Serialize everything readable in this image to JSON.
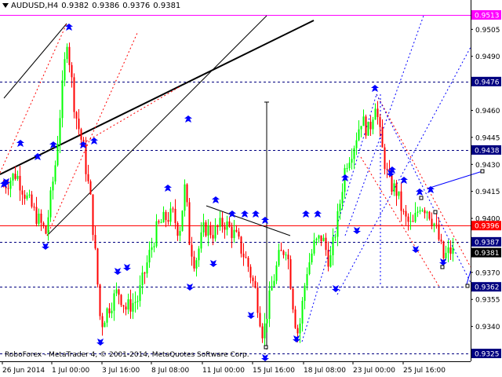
{
  "header": {
    "symbol_timeframe": "AUDUSD,H4",
    "open": "0.9382",
    "high": "0.9386",
    "low": "0.9376",
    "close": "0.9381"
  },
  "copyright": "RoboForex - MetaTrader 4, © 2001-2014, MetaQuotes Software Corp.",
  "colors": {
    "bull": "#00ff00",
    "bear": "#ff0000",
    "level_line": "#000080",
    "label_bg": "#000080",
    "label_text": "#ffffff",
    "current_price_label_bg": "#000000",
    "top_label_bg": "#ff00ff",
    "red_line": "#ff0000",
    "arrow_blue": "#0000ff",
    "trend_blue": "#0000ff",
    "trend_black": "#000000"
  },
  "chart_data": {
    "type": "candlestick",
    "symbol": "AUDUSD",
    "timeframe": "H4",
    "ylim": [
      0.9318,
      0.952
    ],
    "y_ticks": [
      "0.9505",
      "0.9490",
      "0.9460",
      "0.9445",
      "0.9430",
      "0.9415",
      "0.9400",
      "0.9370",
      "0.9355",
      "0.9340"
    ],
    "x_ticks": [
      "26 Jun 2014",
      "1 Jul 00:00",
      "3 Jul 16:00",
      "8 Jul 08:00",
      "11 Jul 00:00",
      "15 Jul 16:00",
      "18 Jul 08:00",
      "23 Jul 00:00",
      "25 Jul 16:00"
    ],
    "price_labels": [
      {
        "value": "0.9513",
        "style": "magenta"
      },
      {
        "value": "0.9476",
        "style": "navy"
      },
      {
        "value": "0.9438",
        "style": "navy"
      },
      {
        "value": "0.9396",
        "style": "red"
      },
      {
        "value": "0.9387",
        "style": "navy"
      },
      {
        "value": "0.9381",
        "style": "black"
      },
      {
        "value": "0.9362",
        "style": "navy"
      },
      {
        "value": "0.9325",
        "style": "navy"
      }
    ],
    "current_price": 0.9381,
    "grid": false
  }
}
